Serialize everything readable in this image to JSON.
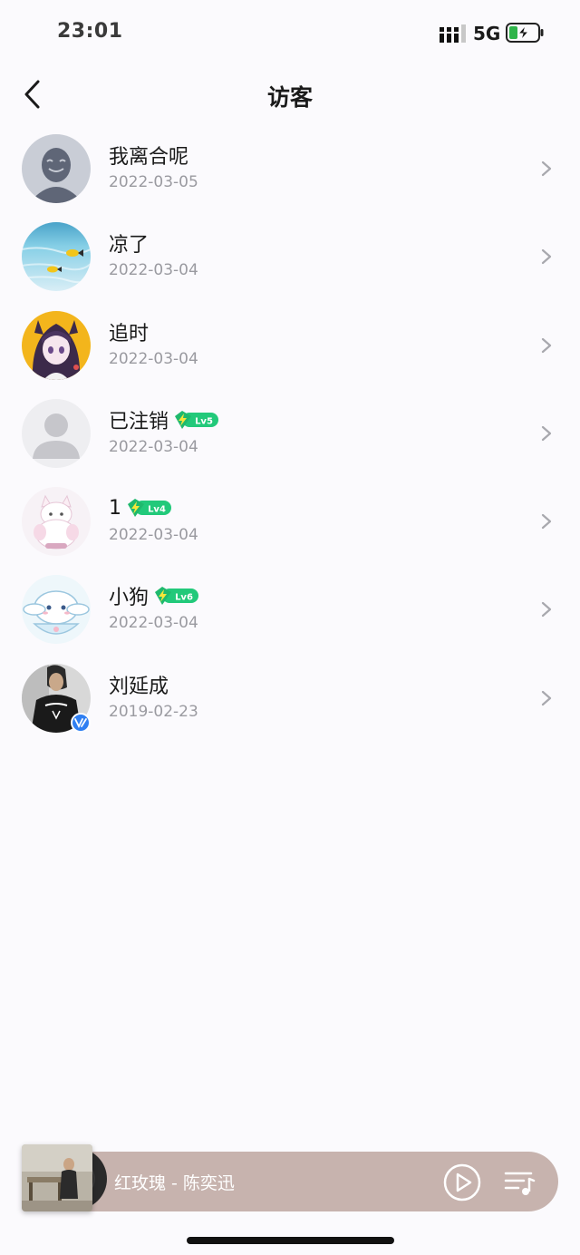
{
  "status_bar": {
    "time": "23:01",
    "network": "5G"
  },
  "nav": {
    "title": "访客"
  },
  "visitors": [
    {
      "name": "我离合呢",
      "date": "2022-03-05",
      "avatar": "default-gray-avatar"
    },
    {
      "name": "凉了",
      "date": "2022-03-04",
      "avatar": "sea-fish-avatar"
    },
    {
      "name": "追时",
      "date": "2022-03-04",
      "avatar": "anime-girl-avatar"
    },
    {
      "name": "已注销",
      "date": "2022-03-04",
      "avatar": "deleted-user-avatar",
      "badge": "Lv5"
    },
    {
      "name": "1",
      "date": "2022-03-04",
      "avatar": "white-cat-avatar",
      "badge": "Lv4"
    },
    {
      "name": "小狗",
      "date": "2022-03-04",
      "avatar": "cinnamoroll-avatar",
      "badge": "Lv6"
    },
    {
      "name": "刘延成",
      "date": "2019-02-23",
      "avatar": "photo-person-avatar"
    }
  ],
  "player": {
    "song": "红玫瑰 - 陈奕迅",
    "bar_color": "#c7b3ae"
  },
  "colors": {
    "background": "#fbfafd",
    "badge_green": "#22c97a",
    "date_gray": "#9a9aa0"
  }
}
